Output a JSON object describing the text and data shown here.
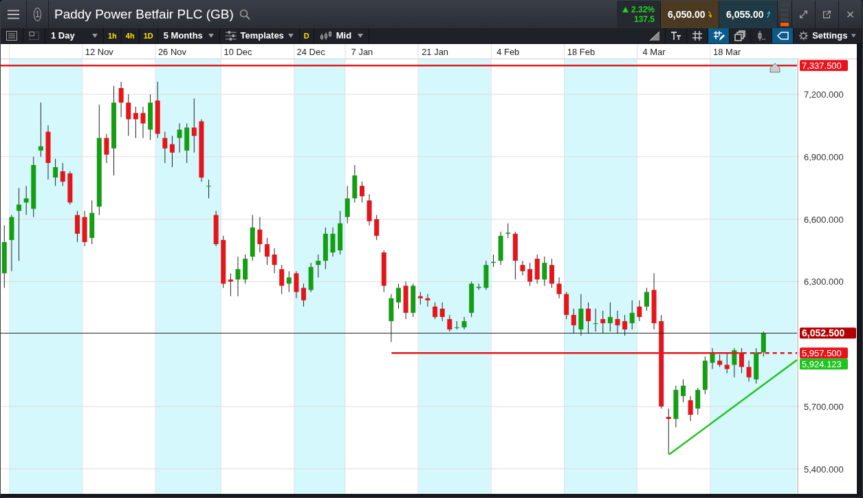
{
  "header": {
    "badge": "1",
    "title": "Paddy Power Betfair PLC (GB)",
    "change": {
      "percent": "2.32%",
      "points": "137.5"
    },
    "sell": "6,050.00",
    "buy": "6,055.00"
  },
  "toolbar": {
    "interval": "1 Day",
    "quick_intervals": [
      "1h",
      "4h",
      "1D"
    ],
    "range": "5 Months",
    "templates": "Templates",
    "mode": "D",
    "price_type": "Mid",
    "settings": "Settings",
    "tools": [
      {
        "kind": "area",
        "selected": false
      },
      {
        "kind": "text",
        "selected": false
      },
      {
        "kind": "grid",
        "selected": false
      },
      {
        "kind": "grid-draw",
        "selected": true
      },
      {
        "kind": "layers",
        "selected": false
      },
      {
        "kind": "crosshair",
        "selected": false
      },
      {
        "kind": "tag",
        "selected": true
      }
    ]
  },
  "chart": {
    "chart_data": {
      "type": "candlestick",
      "ylim": [
        5281,
        7368
      ],
      "grid": true,
      "categories": [
        null,
        null,
        null,
        null,
        null,
        null,
        null,
        null,
        null,
        null,
        null,
        null,
        null,
        "12 Nov",
        null,
        null,
        null,
        null,
        null,
        null,
        null,
        null,
        null,
        "26 Nov",
        null,
        null,
        null,
        null,
        null,
        null,
        null,
        null,
        "10 Dec",
        null,
        null,
        null,
        null,
        null,
        null,
        null,
        null,
        null,
        "24 Dec",
        null,
        null,
        null,
        null,
        null,
        null,
        "7 Jan",
        null,
        null,
        null,
        null,
        null,
        null,
        null,
        null,
        null,
        "21 Jan",
        null,
        null,
        null,
        null,
        null,
        null,
        null,
        null,
        null,
        "4 Feb",
        null,
        null,
        null,
        null,
        null,
        null,
        null,
        null,
        null,
        "18 Feb",
        null,
        null,
        null,
        null,
        null,
        null,
        null,
        null,
        null,
        "4 Mar",
        null,
        null,
        null,
        null,
        null,
        null,
        null,
        null,
        null,
        "18 Mar",
        null,
        null,
        null,
        null,
        null,
        null,
        null,
        null,
        null
      ],
      "yticks": [
        {
          "value": 7200,
          "label": "7,200.000"
        },
        {
          "value": 6900,
          "label": "6,900.000"
        },
        {
          "value": 6600,
          "label": "6,600.000"
        },
        {
          "value": 6300,
          "label": "6,300.000"
        },
        {
          "value": 5700,
          "label": "5,700.000"
        },
        {
          "value": 5400,
          "label": "5,400.000"
        }
      ],
      "ohlc": [
        [
          6340,
          6570,
          6270,
          6490
        ],
        [
          6500,
          6620,
          6350,
          6610
        ],
        [
          6640,
          6750,
          6400,
          6670
        ],
        [
          6680,
          6760,
          6620,
          6700
        ],
        [
          6650,
          6900,
          6610,
          6860
        ],
        [
          6930,
          7160,
          6900,
          6950
        ],
        [
          7020,
          7050,
          6790,
          6870
        ],
        [
          6800,
          6890,
          6760,
          6850
        ],
        [
          6830,
          6870,
          6760,
          6780
        ],
        [
          6820,
          6830,
          6670,
          6680
        ],
        [
          6620,
          6640,
          6490,
          6530
        ],
        [
          6610,
          6640,
          6470,
          6490
        ],
        [
          6510,
          6690,
          6480,
          6630
        ],
        [
          6660,
          7150,
          6620,
          6990
        ],
        [
          6990,
          7010,
          6870,
          6910
        ],
        [
          6940,
          7240,
          6810,
          7160
        ],
        [
          7230,
          7260,
          7090,
          7160
        ],
        [
          7160,
          7200,
          7000,
          7080
        ],
        [
          7110,
          7140,
          6990,
          7080
        ],
        [
          7110,
          7140,
          6990,
          7060
        ],
        [
          7030,
          7200,
          6980,
          7160
        ],
        [
          7170,
          7260,
          6990,
          7010
        ],
        [
          6990,
          7020,
          6870,
          6940
        ],
        [
          6960,
          7000,
          6850,
          6920
        ],
        [
          6990,
          7060,
          6920,
          7030
        ],
        [
          6930,
          7060,
          6870,
          7040
        ],
        [
          7040,
          7180,
          6920,
          7000
        ],
        [
          7070,
          7080,
          6780,
          6800
        ],
        [
          6760,
          6790,
          6700,
          6760
        ],
        [
          6620,
          6640,
          6470,
          6480
        ],
        [
          6500,
          6520,
          6270,
          6290
        ],
        [
          6310,
          6340,
          6230,
          6300
        ],
        [
          6310,
          6420,
          6230,
          6360
        ],
        [
          6310,
          6430,
          6290,
          6410
        ],
        [
          6420,
          6620,
          6400,
          6560
        ],
        [
          6550,
          6610,
          6440,
          6480
        ],
        [
          6480,
          6510,
          6380,
          6420
        ],
        [
          6430,
          6460,
          6340,
          6380
        ],
        [
          6360,
          6380,
          6240,
          6280
        ],
        [
          6290,
          6350,
          6250,
          6320
        ],
        [
          6340,
          6350,
          6220,
          6250
        ],
        [
          6270,
          6290,
          6180,
          6210
        ],
        [
          6260,
          6390,
          6250,
          6370
        ],
        [
          6380,
          6430,
          6320,
          6400
        ],
        [
          6400,
          6560,
          6360,
          6530
        ],
        [
          6440,
          6560,
          6420,
          6530
        ],
        [
          6450,
          6640,
          6430,
          6580
        ],
        [
          6610,
          6760,
          6580,
          6700
        ],
        [
          6700,
          6860,
          6680,
          6810
        ],
        [
          6760,
          6780,
          6680,
          6710
        ],
        [
          6690,
          6720,
          6570,
          6590
        ],
        [
          6600,
          6620,
          6500,
          6520
        ],
        [
          6440,
          6450,
          6250,
          6280
        ],
        [
          6110,
          6240,
          6010,
          6220
        ],
        [
          6200,
          6290,
          6170,
          6270
        ],
        [
          6280,
          6300,
          6120,
          6150
        ],
        [
          6150,
          6290,
          6130,
          6280
        ],
        [
          6230,
          6250,
          6190,
          6220
        ],
        [
          6220,
          6240,
          6180,
          6210
        ],
        [
          6180,
          6200,
          6120,
          6130
        ],
        [
          6170,
          6200,
          6110,
          6130
        ],
        [
          6120,
          6140,
          6060,
          6070
        ],
        [
          6080,
          6110,
          6070,
          6080
        ],
        [
          6080,
          6130,
          6070,
          6110
        ],
        [
          6150,
          6300,
          6130,
          6290
        ],
        [
          6270,
          6290,
          6260,
          6275
        ],
        [
          6270,
          6400,
          6260,
          6380
        ],
        [
          6390,
          6430,
          6370,
          6395
        ],
        [
          6400,
          6540,
          6380,
          6520
        ],
        [
          6530,
          6580,
          6510,
          6535
        ],
        [
          6530,
          6540,
          6310,
          6400
        ],
        [
          6380,
          6400,
          6330,
          6350
        ],
        [
          6360,
          6390,
          6280,
          6300
        ],
        [
          6410,
          6430,
          6290,
          6310
        ],
        [
          6310,
          6420,
          6280,
          6390
        ],
        [
          6380,
          6410,
          6270,
          6290
        ],
        [
          6290,
          6320,
          6220,
          6240
        ],
        [
          6240,
          6250,
          6120,
          6140
        ],
        [
          6140,
          6170,
          6050,
          6090
        ],
        [
          6070,
          6240,
          6040,
          6170
        ],
        [
          6170,
          6200,
          6050,
          6110
        ],
        [
          6100,
          6170,
          6060,
          6100
        ],
        [
          6120,
          6160,
          6050,
          6100
        ],
        [
          6100,
          6200,
          6060,
          6130
        ],
        [
          6120,
          6160,
          6050,
          6090
        ],
        [
          6110,
          6140,
          6040,
          6070
        ],
        [
          6100,
          6210,
          6070,
          6150
        ],
        [
          6180,
          6210,
          6110,
          6130
        ],
        [
          6180,
          6270,
          6160,
          6250
        ],
        [
          6260,
          6340,
          6070,
          6100
        ],
        [
          6110,
          6140,
          5690,
          5700
        ],
        [
          5650,
          5690,
          5470,
          5640
        ],
        [
          5640,
          5800,
          5600,
          5780
        ],
        [
          5750,
          5830,
          5720,
          5800
        ],
        [
          5730,
          5750,
          5630,
          5660
        ],
        [
          5690,
          5790,
          5660,
          5780
        ],
        [
          5780,
          5940,
          5760,
          5920
        ],
        [
          5910,
          5980,
          5880,
          5960
        ],
        [
          5920,
          5950,
          5890,
          5900
        ],
        [
          5900,
          5960,
          5860,
          5880
        ],
        [
          5900,
          5980,
          5840,
          5970
        ],
        [
          5960,
          5980,
          5860,
          5890
        ],
        [
          5890,
          5920,
          5820,
          5840
        ],
        [
          5830,
          5980,
          5810,
          5960
        ],
        [
          5960,
          6060,
          5940,
          6052
        ],
        null,
        null,
        null,
        null
      ]
    },
    "drawings": [
      {
        "kind": "resistance",
        "label": "7,337.500",
        "color": "#e8141b"
      },
      {
        "kind": "current",
        "label": "6,052.500",
        "color": "#b30000"
      },
      {
        "kind": "support",
        "label": "5,957.500",
        "color": "#e8141b"
      },
      {
        "kind": "trend",
        "label": "5,924.123",
        "color": "#1ec41e"
      }
    ]
  }
}
